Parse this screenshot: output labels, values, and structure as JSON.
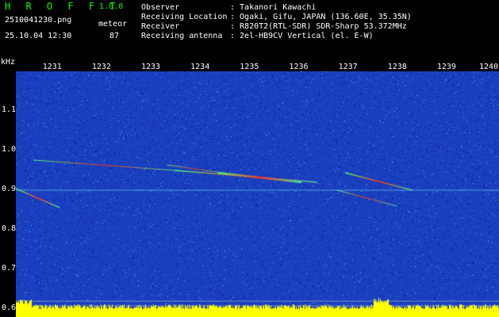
{
  "app": {
    "name": "H R O F F T",
    "version": "1.0.0"
  },
  "file": {
    "name": "2510041230.png",
    "datetime": "25.10.04 12:30"
  },
  "detection": {
    "label": "meteor",
    "count": "87"
  },
  "meta": [
    {
      "key": "Observer",
      "value": ": Takanori Kawachi"
    },
    {
      "key": "Receiving Location",
      "value": ": Ogaki, Gifu, JAPAN (136.60E, 35.35N)"
    },
    {
      "key": "Receiver",
      "value": ": R820T2(RTL-SDR) SDR-Sharp 53.372MHz"
    },
    {
      "key": "Receiving antenna",
      "value": ": 2el-HB9CV Vertical (el. E-W)"
    }
  ],
  "chart_data": {
    "type": "heatmap",
    "ylabel": "kHz",
    "yticks": [
      "1.1",
      "1.0",
      "0.9",
      "0.8",
      "0.7",
      "0.6"
    ],
    "y_values": [
      1.1,
      1.0,
      0.9,
      0.8,
      0.7,
      0.6
    ],
    "ylim": [
      0.58,
      1.2
    ],
    "xticks": [
      "1231",
      "1232",
      "1233",
      "1234",
      "1235",
      "1236",
      "1237",
      "1238",
      "1239",
      "1240"
    ],
    "x_values": [
      1231,
      1232,
      1233,
      1234,
      1235,
      1236,
      1237,
      1238,
      1239,
      1240
    ],
    "xlim": [
      1230.2,
      1240
    ],
    "carrier_khz": 0.9,
    "colors": {
      "background": "#1a3fbf",
      "signal": "#ff3020",
      "carrier": "#7fe0ff",
      "level": "#ffff00"
    }
  }
}
